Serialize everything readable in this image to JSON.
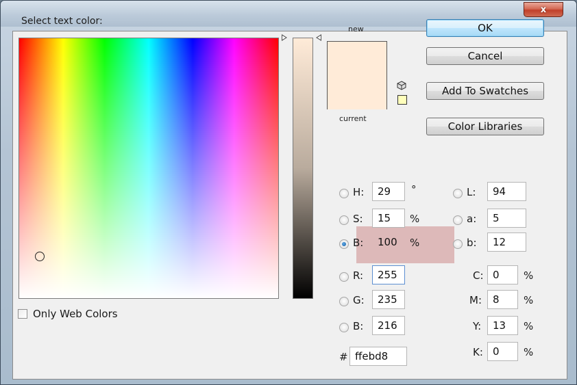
{
  "window": {
    "title": "Select text color:",
    "close_glyph": "x"
  },
  "picker": {
    "swatch_new_label": "new",
    "swatch_current_label": "current",
    "new_color": "#ffebd8",
    "current_color": "#ffebd8",
    "only_web_colors_label": "Only Web Colors",
    "only_web_colors_checked": false
  },
  "buttons": {
    "ok": "OK",
    "cancel": "Cancel",
    "add_to_swatches": "Add To Swatches",
    "color_libraries": "Color Libraries"
  },
  "hsb": {
    "h": {
      "label": "H:",
      "value": "29",
      "unit": "°",
      "selected": false
    },
    "s": {
      "label": "S:",
      "value": "15",
      "unit": "%",
      "selected": false
    },
    "b": {
      "label": "B:",
      "value": "100",
      "unit": "%",
      "selected": true
    }
  },
  "rgb": {
    "r": {
      "label": "R:",
      "value": "255",
      "selected": false
    },
    "g": {
      "label": "G:",
      "value": "235",
      "selected": false
    },
    "b": {
      "label": "B:",
      "value": "216",
      "selected": false
    }
  },
  "lab": {
    "l": {
      "label": "L:",
      "value": "94",
      "selected": false
    },
    "a": {
      "label": "a:",
      "value": "5",
      "selected": false
    },
    "b": {
      "label": "b:",
      "value": "12",
      "selected": false
    }
  },
  "cmyk": {
    "c": {
      "label": "C:",
      "value": "0",
      "unit": "%"
    },
    "m": {
      "label": "M:",
      "value": "8",
      "unit": "%"
    },
    "y": {
      "label": "Y:",
      "value": "13",
      "unit": "%"
    },
    "k": {
      "label": "K:",
      "value": "0",
      "unit": "%"
    }
  },
  "hex": {
    "label": "#",
    "value": "ffebd8"
  },
  "icons": {
    "out_of_gamut_web": "cube-icon",
    "out_of_gamut_print": "gamut-swatch-icon"
  }
}
